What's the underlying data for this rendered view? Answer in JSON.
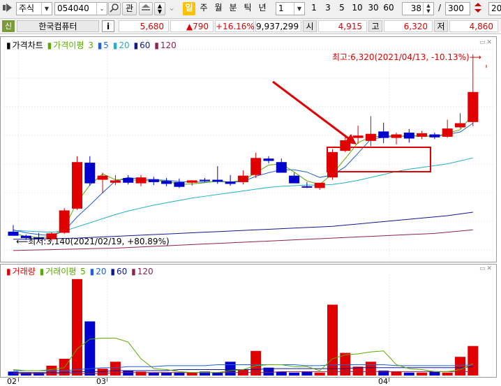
{
  "toolbar": {
    "nav_icon": "arrow-right-icon",
    "market": "주식",
    "code": "054040",
    "btn_gwan": "관",
    "periods": [
      "일",
      "주",
      "월",
      "분",
      "틱",
      "년"
    ],
    "active_period": "일",
    "interval": "1",
    "counts": [
      "1",
      "3",
      "5",
      "10",
      "30",
      "60"
    ],
    "display_count": "38",
    "separator": "/",
    "total_count": "300",
    "right_cut": "20"
  },
  "info": {
    "badge": "신",
    "name": "한국컴퓨터",
    "info_btn": "i",
    "price": "5,680",
    "change": "▲790",
    "change_pct": "+16.16%",
    "volume": "9,937,299",
    "open_label": "시",
    "open": "4,915",
    "high_label": "고",
    "high": "6,320",
    "low_label": "저",
    "low": "4,860"
  },
  "price_panel": {
    "legend_title": "가격차트",
    "legend_ma_label": "가격이평",
    "ma_periods": [
      "3",
      "5",
      "20",
      "60",
      "120"
    ],
    "high_note": "최고:6,320(2021/04/13, -10.13%)",
    "low_note": "최저:3,140(2021/02/19, +80.89%)"
  },
  "volume_panel": {
    "legend_title": "거래량",
    "legend_ma_label": "거래이평",
    "ma_periods": [
      "5",
      "20",
      "60",
      "120"
    ]
  },
  "x_axis": {
    "labels": [
      "02",
      "03",
      "04"
    ]
  },
  "colors": {
    "up": "#e00000",
    "down": "#0000cc",
    "ma3": "#5aaa00",
    "ma5": "#2060d8",
    "ma20": "#20b0c8",
    "ma60": "#101890",
    "ma120": "#902050",
    "annotation": "#e00000"
  },
  "chart_data": {
    "type": "candlestick",
    "price_ylim": [
      3000,
      6400
    ],
    "candles": [
      {
        "o": 3310,
        "h": 3420,
        "l": 3250,
        "c": 3240
      },
      {
        "o": 3240,
        "h": 3260,
        "l": 3170,
        "c": 3200
      },
      {
        "o": 3210,
        "h": 3290,
        "l": 3150,
        "c": 3190
      },
      {
        "o": 3180,
        "h": 3300,
        "l": 3140,
        "c": 3280
      },
      {
        "o": 3290,
        "h": 3710,
        "l": 3270,
        "c": 3670
      },
      {
        "o": 3700,
        "h": 4590,
        "l": 3680,
        "c": 4490
      },
      {
        "o": 4480,
        "h": 4590,
        "l": 4090,
        "c": 4130
      },
      {
        "o": 4190,
        "h": 4310,
        "l": 3960,
        "c": 4260
      },
      {
        "o": 4140,
        "h": 4270,
        "l": 4100,
        "c": 4180
      },
      {
        "o": 4220,
        "h": 4270,
        "l": 4110,
        "c": 4140
      },
      {
        "o": 4130,
        "h": 4270,
        "l": 4080,
        "c": 4230
      },
      {
        "o": 4200,
        "h": 4240,
        "l": 4100,
        "c": 4150
      },
      {
        "o": 4170,
        "h": 4220,
        "l": 4080,
        "c": 4120
      },
      {
        "o": 4150,
        "h": 4210,
        "l": 4050,
        "c": 4070
      },
      {
        "o": 4140,
        "h": 4180,
        "l": 4090,
        "c": 4180
      },
      {
        "o": 4190,
        "h": 4220,
        "l": 4150,
        "c": 4170
      },
      {
        "o": 4190,
        "h": 4420,
        "l": 4120,
        "c": 4160
      },
      {
        "o": 4160,
        "h": 4270,
        "l": 4090,
        "c": 4120
      },
      {
        "o": 4150,
        "h": 4350,
        "l": 4110,
        "c": 4260
      },
      {
        "o": 4270,
        "h": 4650,
        "l": 4220,
        "c": 4560
      },
      {
        "o": 4550,
        "h": 4590,
        "l": 4470,
        "c": 4510
      },
      {
        "o": 4490,
        "h": 4550,
        "l": 4310,
        "c": 4310
      },
      {
        "o": 4260,
        "h": 4310,
        "l": 4130,
        "c": 4130
      },
      {
        "o": 4080,
        "h": 4150,
        "l": 4050,
        "c": 4060
      },
      {
        "o": 4050,
        "h": 4100,
        "l": 4020,
        "c": 4140
      },
      {
        "o": 4230,
        "h": 4710,
        "l": 4190,
        "c": 4660
      },
      {
        "o": 4680,
        "h": 4930,
        "l": 4660,
        "c": 4860
      },
      {
        "o": 4900,
        "h": 5110,
        "l": 4800,
        "c": 4940
      },
      {
        "o": 4850,
        "h": 5270,
        "l": 4760,
        "c": 4970
      },
      {
        "o": 5010,
        "h": 5160,
        "l": 4810,
        "c": 4900
      },
      {
        "o": 4900,
        "h": 4990,
        "l": 4790,
        "c": 4960
      },
      {
        "o": 4990,
        "h": 5050,
        "l": 4820,
        "c": 4890
      },
      {
        "o": 4920,
        "h": 5020,
        "l": 4880,
        "c": 4980
      },
      {
        "o": 4960,
        "h": 4990,
        "l": 4880,
        "c": 4910
      },
      {
        "o": 4920,
        "h": 5210,
        "l": 4900,
        "c": 5060
      },
      {
        "o": 5080,
        "h": 5320,
        "l": 5060,
        "c": 5150
      },
      {
        "o": 5170,
        "h": 6320,
        "l": 5100,
        "c": 5680
      }
    ],
    "volume_ylim": [
      0,
      100
    ],
    "volume": [
      4,
      3,
      3,
      10,
      17,
      98,
      55,
      7,
      14,
      5,
      4,
      3,
      3,
      3,
      3,
      4,
      3,
      14,
      6,
      25,
      8,
      4,
      3,
      4,
      3,
      72,
      23,
      9,
      14,
      5,
      4,
      3,
      3,
      4,
      3,
      19,
      30
    ],
    "ma3": [
      3280,
      3230,
      3210,
      3220,
      3380,
      3810,
      4100,
      4290,
      4190,
      4190,
      4180,
      4170,
      4170,
      4110,
      4120,
      4140,
      4170,
      4150,
      4180,
      4310,
      4440,
      4460,
      4320,
      4170,
      4110,
      4290,
      4550,
      4820,
      4920,
      4930,
      4940,
      4920,
      4940,
      4920,
      4980,
      5040,
      5300
    ],
    "ma5": [
      3340,
      3290,
      3260,
      3240,
      3320,
      3560,
      3760,
      3970,
      4170,
      4230,
      4200,
      4190,
      4180,
      4160,
      4150,
      4150,
      4160,
      4150,
      4160,
      4250,
      4310,
      4360,
      4360,
      4320,
      4230,
      4270,
      4410,
      4640,
      4880,
      4910,
      4930,
      4930,
      4940,
      4920,
      4960,
      5000,
      5150
    ],
    "ma20": [
      3330,
      3320,
      3310,
      3300,
      3320,
      3390,
      3460,
      3530,
      3600,
      3660,
      3710,
      3760,
      3800,
      3840,
      3880,
      3910,
      3940,
      3970,
      4000,
      4030,
      4060,
      4080,
      4090,
      4100,
      4100,
      4110,
      4140,
      4180,
      4230,
      4280,
      4330,
      4370,
      4400,
      4430,
      4460,
      4510,
      4560
    ],
    "ma60": [
      3180,
      3180,
      3185,
      3190,
      3195,
      3200,
      3210,
      3220,
      3230,
      3240,
      3250,
      3260,
      3270,
      3280,
      3290,
      3300,
      3310,
      3320,
      3330,
      3340,
      3350,
      3360,
      3370,
      3380,
      3390,
      3400,
      3420,
      3440,
      3460,
      3480,
      3500,
      3520,
      3540,
      3560,
      3580,
      3610,
      3640
    ],
    "ma120": [
      2990,
      2995,
      3000,
      3005,
      3010,
      3015,
      3020,
      3025,
      3030,
      3040,
      3050,
      3060,
      3070,
      3080,
      3090,
      3100,
      3110,
      3120,
      3130,
      3140,
      3150,
      3160,
      3170,
      3180,
      3190,
      3200,
      3210,
      3220,
      3230,
      3240,
      3250,
      3260,
      3270,
      3280,
      3300,
      3320,
      3340
    ],
    "vol_ma5": [
      6,
      5,
      5,
      6,
      8,
      27,
      37,
      38,
      38,
      34,
      17,
      7,
      6,
      4,
      3,
      3,
      3,
      5,
      6,
      10,
      11,
      11,
      9,
      9,
      5,
      17,
      21,
      22,
      24,
      25,
      11,
      7,
      6,
      4,
      4,
      6,
      12
    ],
    "vol_ma20": [
      5,
      5,
      5,
      5,
      5,
      6,
      7,
      8,
      8,
      9,
      9,
      9,
      10,
      10,
      10,
      10,
      11,
      11,
      11,
      11,
      11,
      11,
      11,
      10,
      10,
      11,
      11,
      11,
      11,
      11,
      10,
      10,
      10,
      10,
      10,
      10,
      11
    ],
    "vol_ma60": [
      3,
      3,
      3,
      3,
      3,
      4,
      4,
      4,
      5,
      5,
      5,
      5,
      5,
      6,
      6,
      6,
      6,
      6,
      6,
      6,
      7,
      7,
      7,
      7,
      7,
      7,
      7,
      8,
      8,
      8,
      8,
      8,
      8,
      8,
      8,
      8,
      9
    ],
    "vol_ma120": [
      2,
      2,
      2,
      2,
      2,
      2,
      2,
      2,
      3,
      3,
      3,
      3,
      3,
      3,
      3,
      3,
      3,
      3,
      3,
      3,
      3,
      4,
      4,
      4,
      4,
      4,
      4,
      4,
      4,
      4,
      4,
      4,
      4,
      4,
      4,
      4,
      4
    ]
  }
}
